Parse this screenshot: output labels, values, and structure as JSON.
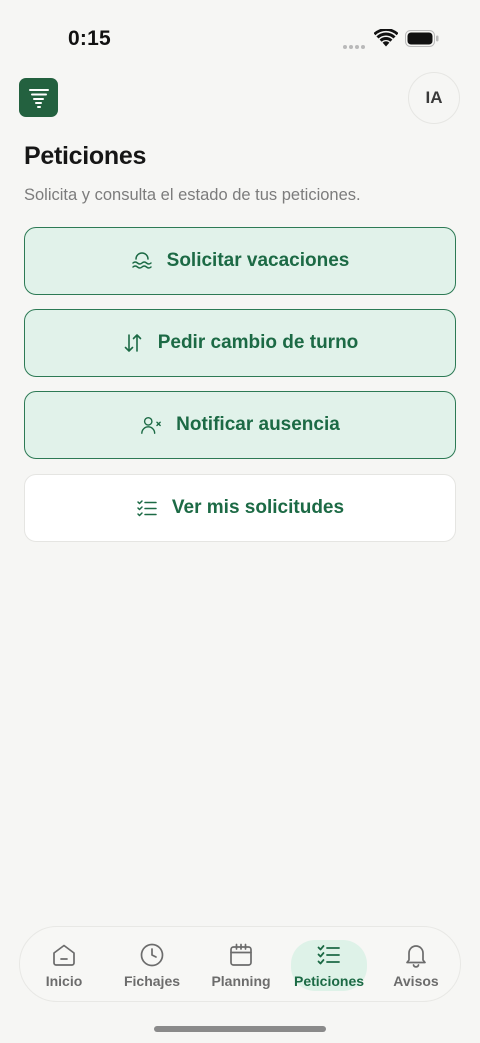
{
  "status_bar": {
    "time": "0:15"
  },
  "header": {
    "avatar_initials": "IA"
  },
  "page": {
    "title": "Peticiones",
    "subtitle": "Solicita y consulta el estado de tus peticiones."
  },
  "actions": [
    {
      "label": "Solicitar vacaciones",
      "icon": "waves-icon",
      "style": "primary"
    },
    {
      "label": "Pedir cambio de turno",
      "icon": "swap-arrows-icon",
      "style": "primary"
    },
    {
      "label": "Notificar ausencia",
      "icon": "user-x-icon",
      "style": "primary"
    },
    {
      "label": "Ver mis solicitudes",
      "icon": "checklist-icon",
      "style": "outline"
    }
  ],
  "tabs": [
    {
      "label": "Inicio",
      "icon": "home-icon",
      "active": false
    },
    {
      "label": "Fichajes",
      "icon": "clock-icon",
      "active": false
    },
    {
      "label": "Planning",
      "icon": "calendar-icon",
      "active": false
    },
    {
      "label": "Peticiones",
      "icon": "checklist-icon",
      "active": true
    },
    {
      "label": "Avisos",
      "icon": "bell-icon",
      "active": false
    }
  ],
  "colors": {
    "accent": "#1c6a45",
    "accent_light": "#e1f2ea",
    "background": "#f6f6f4",
    "logo_bg": "#23613f"
  }
}
